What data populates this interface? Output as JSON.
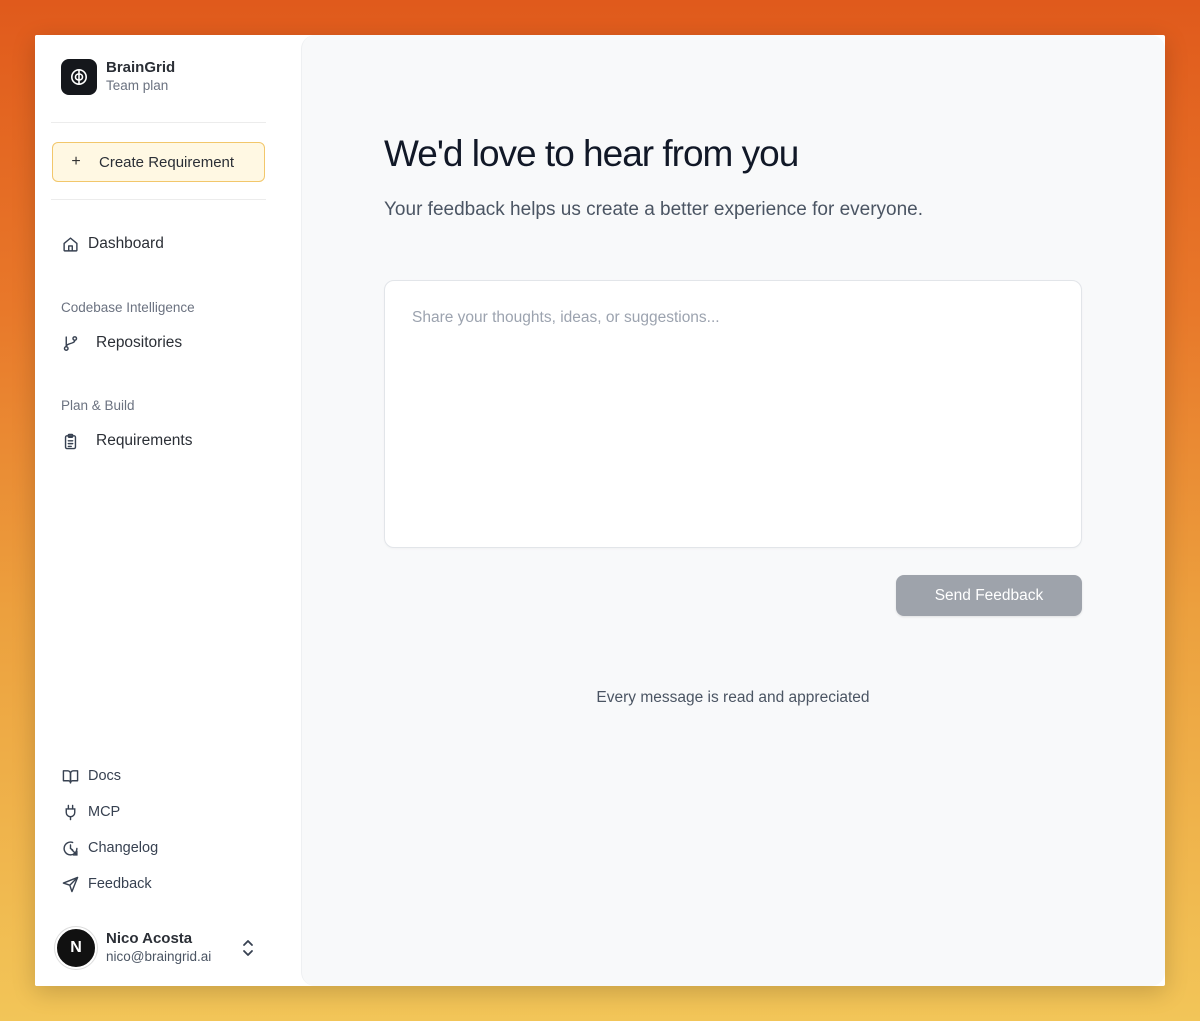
{
  "brand": {
    "name": "BrainGrid",
    "plan": "Team plan"
  },
  "sidebar": {
    "create_label": "Create Requirement",
    "dashboard": "Dashboard",
    "section_codebase": "Codebase Intelligence",
    "repositories": "Repositories",
    "section_plan": "Plan & Build",
    "requirements": "Requirements",
    "footer": {
      "docs": "Docs",
      "mcp": "MCP",
      "changelog": "Changelog",
      "feedback": "Feedback"
    }
  },
  "user": {
    "name": "Nico Acosta",
    "email": "nico@braingrid.ai",
    "initial": "N"
  },
  "main": {
    "title": "We'd love to hear from you",
    "subtitle": "Your feedback helps us create a better experience for everyone.",
    "placeholder": "Share your thoughts, ideas, or suggestions...",
    "send_label": "Send Feedback",
    "note": "Every message is read and appreciated"
  },
  "colors": {
    "accent_border": "#f2c76b",
    "accent_bg": "#fff8e3",
    "button_disabled": "#9ea3ab",
    "logo_bg": "#15171c"
  },
  "icons": {
    "brand": "brain-icon",
    "create": "plus-icon",
    "dashboard": "home-icon",
    "repositories": "git-branch-icon",
    "requirements": "clipboard-list-icon",
    "docs": "book-open-icon",
    "mcp": "plug-icon",
    "changelog": "clock-icon",
    "feedback": "send-icon",
    "user_toggle": "chevrons-up-down-icon"
  }
}
